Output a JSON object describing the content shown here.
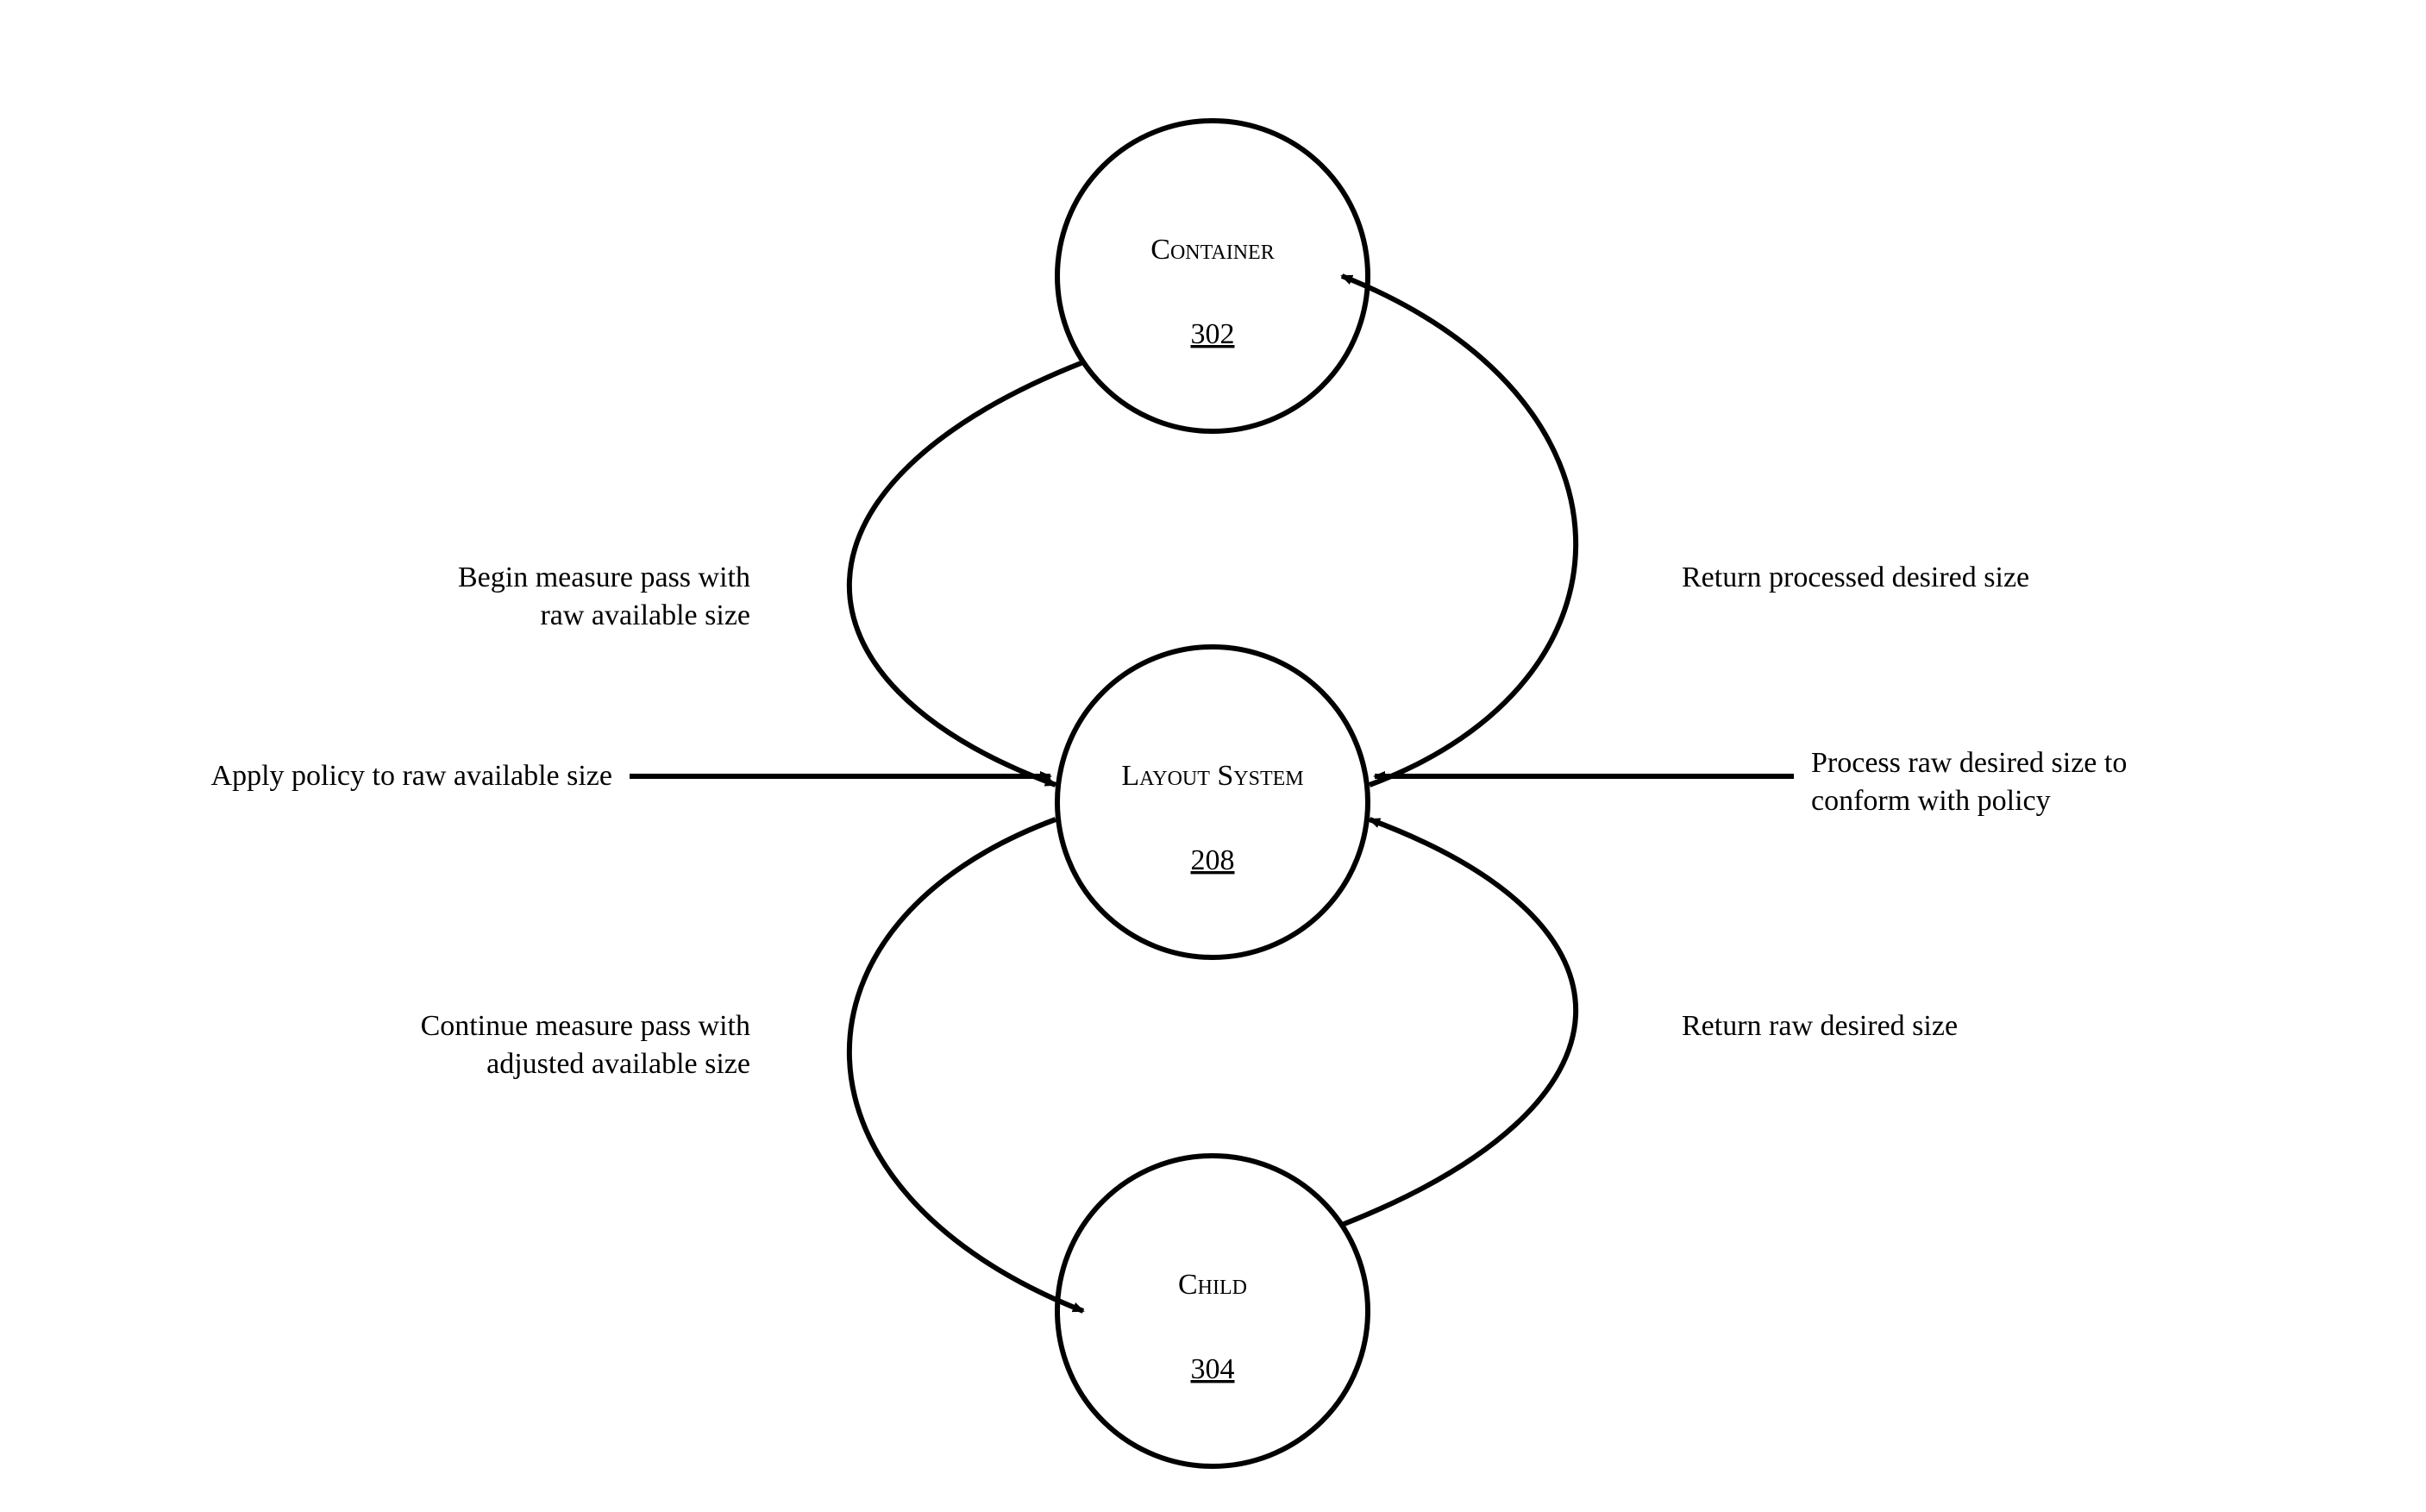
{
  "diagram": {
    "nodes": {
      "container": {
        "title": "Container",
        "ref": "302"
      },
      "layout": {
        "title": "Layout System",
        "ref": "208"
      },
      "child": {
        "title": "Child",
        "ref": "304"
      }
    },
    "edges": {
      "top_left": {
        "line1": "Begin measure pass with",
        "line2": "raw available size"
      },
      "top_right": {
        "line1": "Return processed desired size"
      },
      "mid_left": {
        "line1": "Apply policy to raw available size"
      },
      "mid_right": {
        "line1": "Process raw desired size to",
        "line2": "conform with policy"
      },
      "bottom_left": {
        "line1": "Continue measure pass with",
        "line2": "adjusted available size"
      },
      "bottom_right": {
        "line1": "Return raw desired size"
      }
    }
  }
}
